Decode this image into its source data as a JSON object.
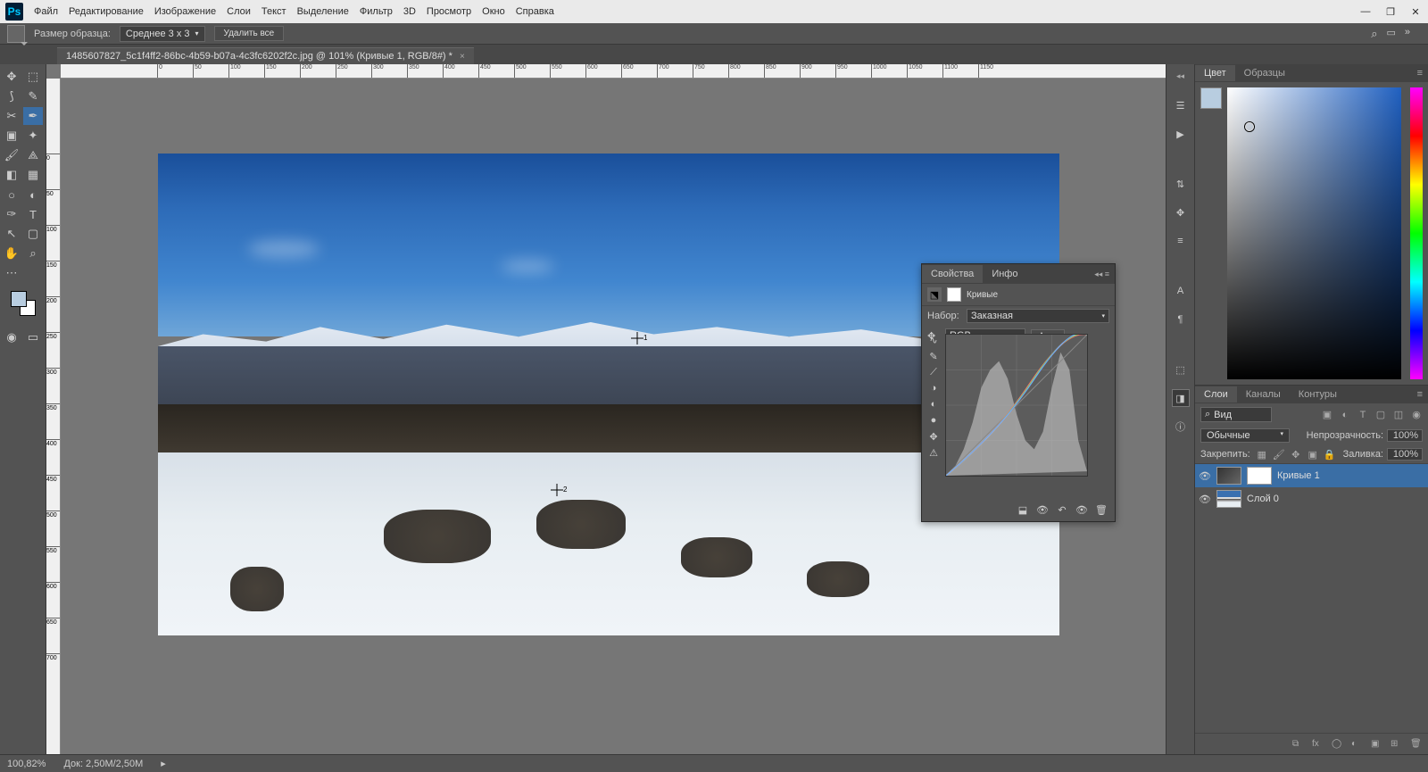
{
  "menu": [
    "Файл",
    "Редактирование",
    "Изображение",
    "Слои",
    "Текст",
    "Выделение",
    "Фильтр",
    "3D",
    "Просмотр",
    "Окно",
    "Справка"
  ],
  "options": {
    "sample_label": "Размер образца:",
    "sample_value": "Среднее 3 x 3",
    "clear_all": "Удалить все"
  },
  "tab": {
    "title": "1485607827_5c1f4ff2-86bc-4b59-b07a-4c3fc6202f2c.jpg @ 101% (Кривые 1, RGB/8#) *"
  },
  "ruler_h": [
    0,
    50,
    100,
    150,
    200,
    250,
    300,
    350,
    400,
    450,
    500,
    550,
    600,
    650,
    700,
    750,
    800,
    850,
    900,
    950,
    1000,
    1050,
    1100,
    1150
  ],
  "ruler_v": [
    0,
    50,
    100,
    150,
    200,
    250,
    300,
    350,
    400,
    450,
    500,
    550,
    600,
    650,
    700
  ],
  "panels": {
    "color": {
      "tabs": [
        "Цвет",
        "Образцы"
      ]
    },
    "properties": {
      "tabs": [
        "Свойства",
        "Инфо"
      ],
      "title": "Кривые",
      "preset_label": "Набор:",
      "preset_value": "Заказная",
      "channel_value": "RGB",
      "auto": "Авто"
    },
    "layers": {
      "tabs": [
        "Слои",
        "Каналы",
        "Контуры"
      ],
      "kind": "Вид",
      "blend": "Обычные",
      "opacity_label": "Непрозрачность:",
      "opacity": "100%",
      "fill_label": "Заливка:",
      "fill": "100%",
      "lock_label": "Закрепить:",
      "items": [
        {
          "name": "Кривые 1"
        },
        {
          "name": "Слой 0"
        }
      ]
    }
  },
  "status": {
    "zoom": "100,82%",
    "doc": "Док: 2,50M/2,50M"
  },
  "samples": {
    "s1": "1",
    "s2": "2"
  }
}
